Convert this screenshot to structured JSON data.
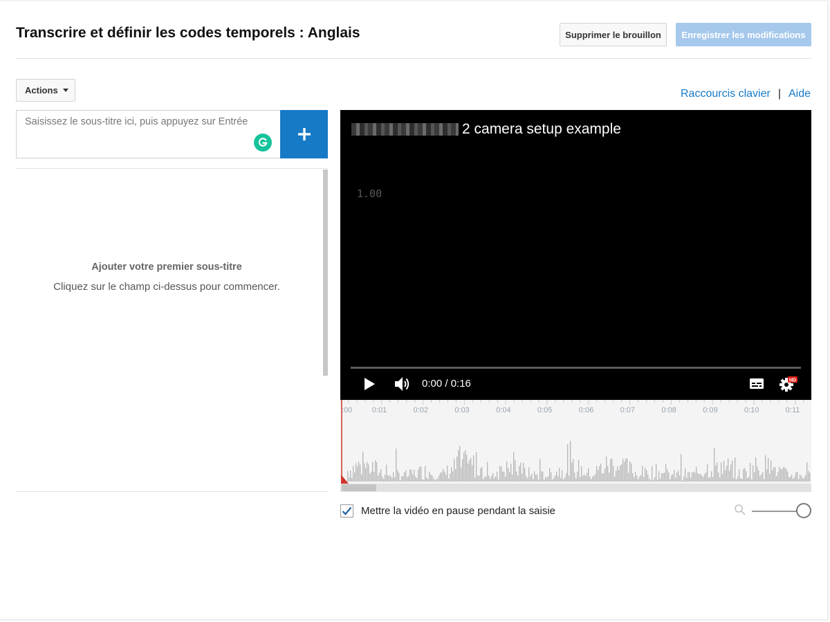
{
  "header": {
    "title": "Transcrire et définir les codes temporels : Anglais",
    "delete_label": "Supprimer le brouillon",
    "save_label": "Enregistrer les modifications"
  },
  "toolbar": {
    "actions_label": "Actions",
    "shortcuts_link": "Raccourcis clavier",
    "separator": "|",
    "help_link": "Aide"
  },
  "subtitle_input": {
    "placeholder": "Saisissez le sous-titre ici, puis appuyez sur Entrée",
    "add_button_icon": "plus-icon"
  },
  "empty_state": {
    "title": "Ajouter votre premier sous-titre",
    "subtitle": "Cliquez sur le champ ci-dessus pour commencer."
  },
  "video": {
    "title": "2 camera setup example",
    "playback_rate": "1.00",
    "time_display": "0:00 / 0:16",
    "progress": 0,
    "icons": [
      "play-icon",
      "volume-icon",
      "subtitles-icon",
      "settings-icon"
    ],
    "hd_badge": "HD"
  },
  "timeline": {
    "ticks": [
      ":00",
      "0:01",
      "0:02",
      "0:03",
      "0:04",
      "0:05",
      "0:06",
      "0:07",
      "0:08",
      "0:09",
      "0:10",
      "0:11"
    ]
  },
  "pause_option": {
    "label": "Mettre la vidéo en pause pendant la saisie",
    "checked": true
  },
  "zoom": {
    "level": 1.0
  },
  "colors": {
    "accent": "#167ac6",
    "save_disabled": "#a6c8ec",
    "waveform": "#b5b5b5",
    "playhead": "#d0342c"
  }
}
